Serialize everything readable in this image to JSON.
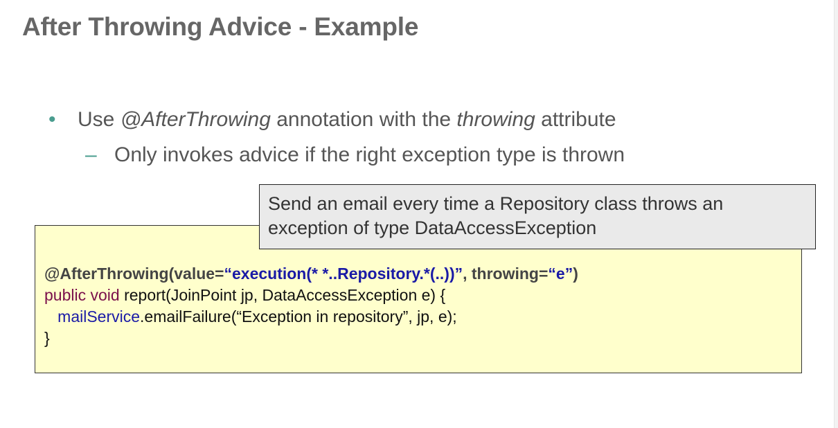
{
  "slide": {
    "title": "After Throwing Advice - Example",
    "bullet": {
      "marker": "•",
      "prefix": "Use ",
      "annotation": "@AfterThrowing",
      "middle": " annotation with the ",
      "attribute": "throwing",
      "suffix": " attribute"
    },
    "subbullet": {
      "marker": "–",
      "text": "Only invokes advice if the right exception type is thrown"
    },
    "callout": {
      "line1": "Send an email every time a Repository class throws an",
      "line2": "exception of type DataAccessException"
    },
    "code": {
      "line1": {
        "a": "@AfterThrowing(value=",
        "b": "“execution(* *..Repository.*(..))”",
        "c": ", throwing=",
        "d": "“e”",
        "e": ")"
      },
      "line2": {
        "kw": "public void",
        "rest": " report(JoinPoint jp, DataAccessException e) {"
      },
      "line3": {
        "indent": "   ",
        "field": "mailService",
        "rest": ".emailFailure(“Exception in repository”, jp, e);"
      },
      "line4": "}"
    }
  }
}
